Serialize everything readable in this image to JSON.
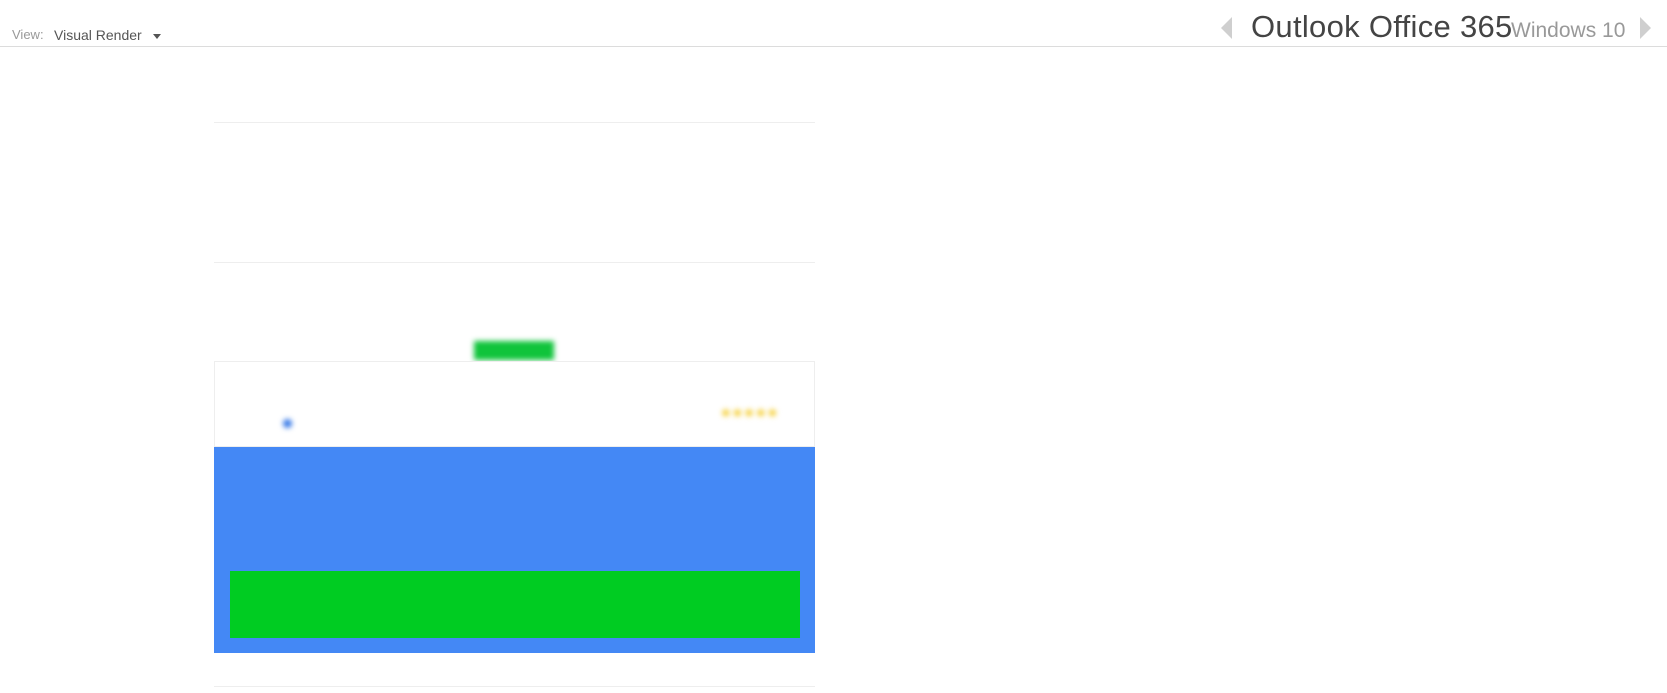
{
  "toolbar": {
    "view_label": "View:",
    "view_value": "Visual Render"
  },
  "preview": {
    "client": "Outlook Office 365",
    "os": "Windows 10"
  },
  "email": {
    "logo": "",
    "headline": "",
    "intro_line1": "",
    "intro_line2": "",
    "promo_text": "",
    "badge": "",
    "card": {
      "small_text": "",
      "brand": "",
      "tag": "",
      "stars": "★★★★★",
      "rating": 5
    },
    "rows": [
      {
        "label": "",
        "value": ""
      },
      {
        "label": "",
        "value": ""
      },
      {
        "label": "",
        "value": ""
      },
      {
        "label": "",
        "value": ""
      }
    ],
    "cta_label": "",
    "footer": ""
  },
  "colors": {
    "accent_blue": "#4488f5",
    "cta_green": "#00cc22",
    "badge_green": "#10c43b",
    "star_gold": "#f2c200"
  }
}
